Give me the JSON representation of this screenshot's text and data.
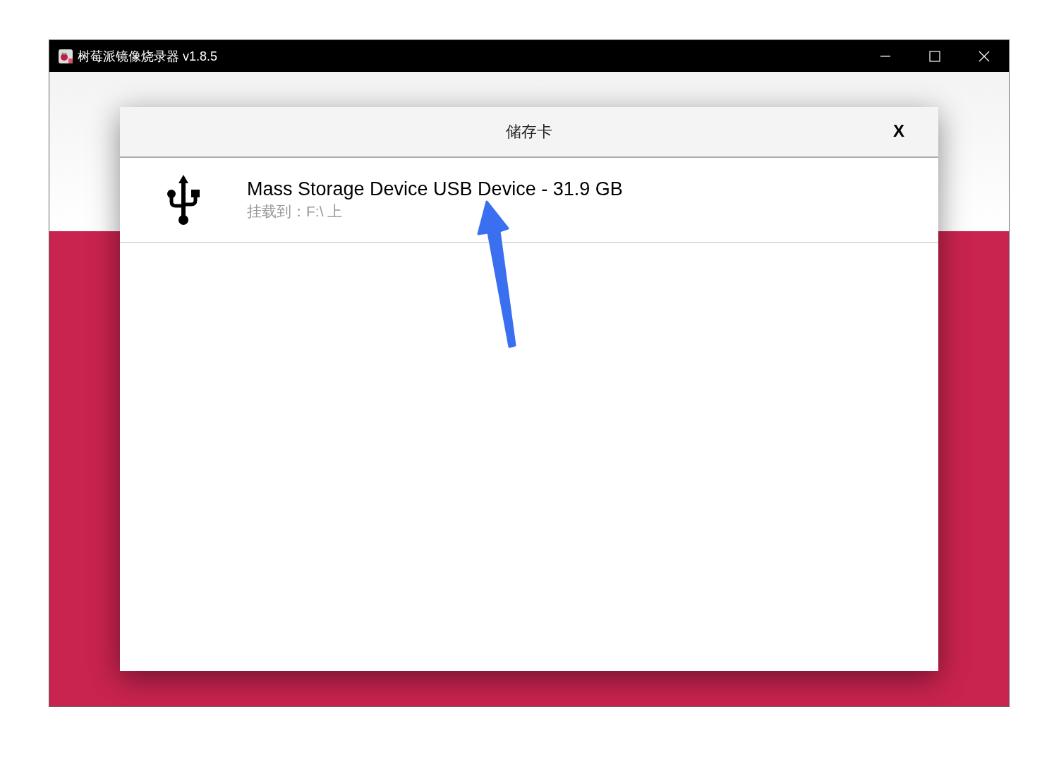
{
  "window": {
    "title": "树莓派镜像烧录器 v1.8.5"
  },
  "dialog": {
    "title": "储存卡",
    "close_label": "X",
    "devices": [
      {
        "name": "Mass Storage Device USB Device - 31.9 GB",
        "mount": "挂载到：F:\\ 上"
      }
    ]
  }
}
